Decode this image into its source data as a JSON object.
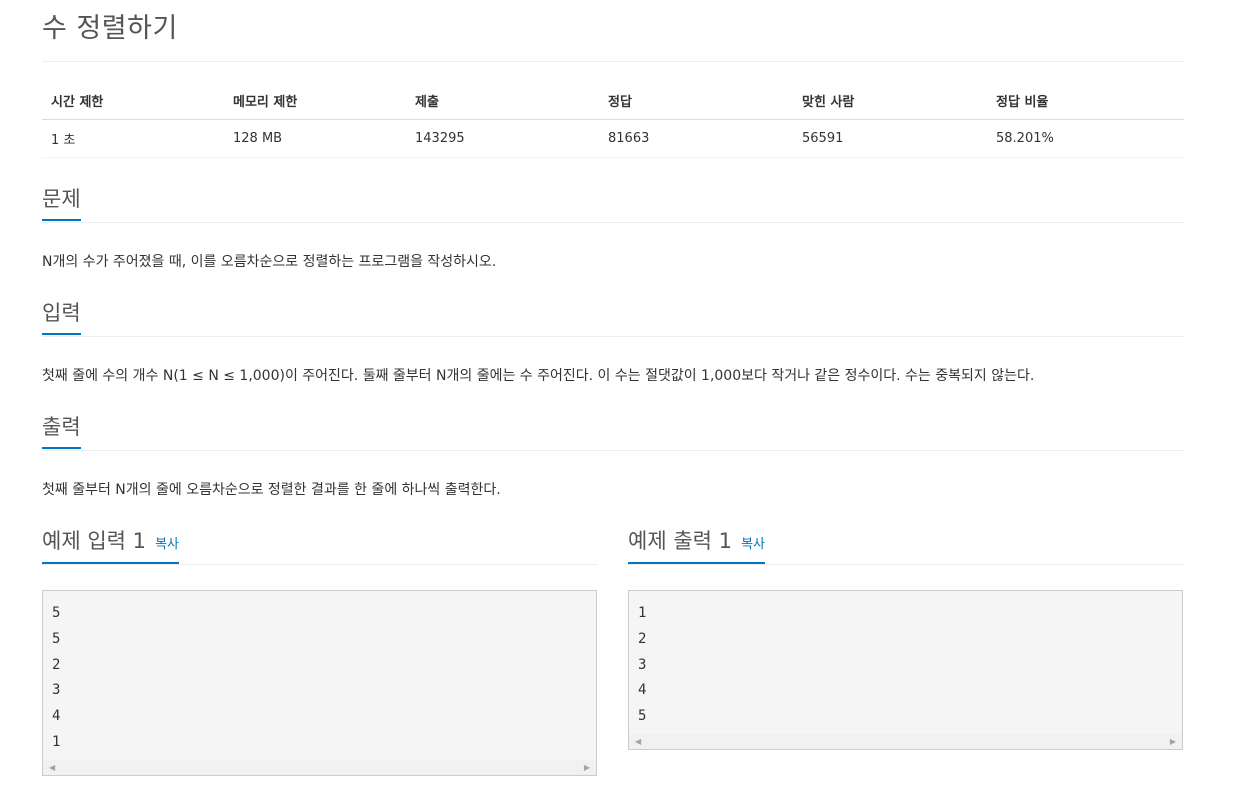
{
  "title": "수 정렬하기",
  "info_table": {
    "headers": [
      "시간 제한",
      "메모리 제한",
      "제출",
      "정답",
      "맞힌 사람",
      "정답 비율"
    ],
    "values": [
      "1 초",
      "128 MB",
      "143295",
      "81663",
      "56591",
      "58.201%"
    ]
  },
  "sections": {
    "problem": {
      "heading": "문제",
      "text": "N개의 수가 주어졌을 때, 이를 오름차순으로 정렬하는 프로그램을 작성하시오."
    },
    "input": {
      "heading": "입력",
      "text": "첫째 줄에 수의 개수 N(1 ≤ N ≤ 1,000)이 주어진다. 둘째 줄부터 N개의 줄에는 수 주어진다. 이 수는 절댓값이 1,000보다 작거나 같은 정수이다. 수는 중복되지 않는다."
    },
    "output": {
      "heading": "출력",
      "text": "첫째 줄부터 N개의 줄에 오름차순으로 정렬한 결과를 한 줄에 하나씩 출력한다."
    }
  },
  "samples": {
    "input": {
      "heading": "예제 입력 1",
      "copy_label": "복사",
      "lines": [
        "5",
        "5",
        "2",
        "3",
        "4",
        "1"
      ]
    },
    "output": {
      "heading": "예제 출력 1",
      "copy_label": "복사",
      "lines": [
        "1",
        "2",
        "3",
        "4",
        "5"
      ]
    }
  },
  "icons": {
    "scroll_left": "scroll-left-arrow-icon",
    "scroll_right": "scroll-right-arrow-icon"
  },
  "colors": {
    "accent": "#0076c0",
    "code_background": "#f5f5f5"
  }
}
